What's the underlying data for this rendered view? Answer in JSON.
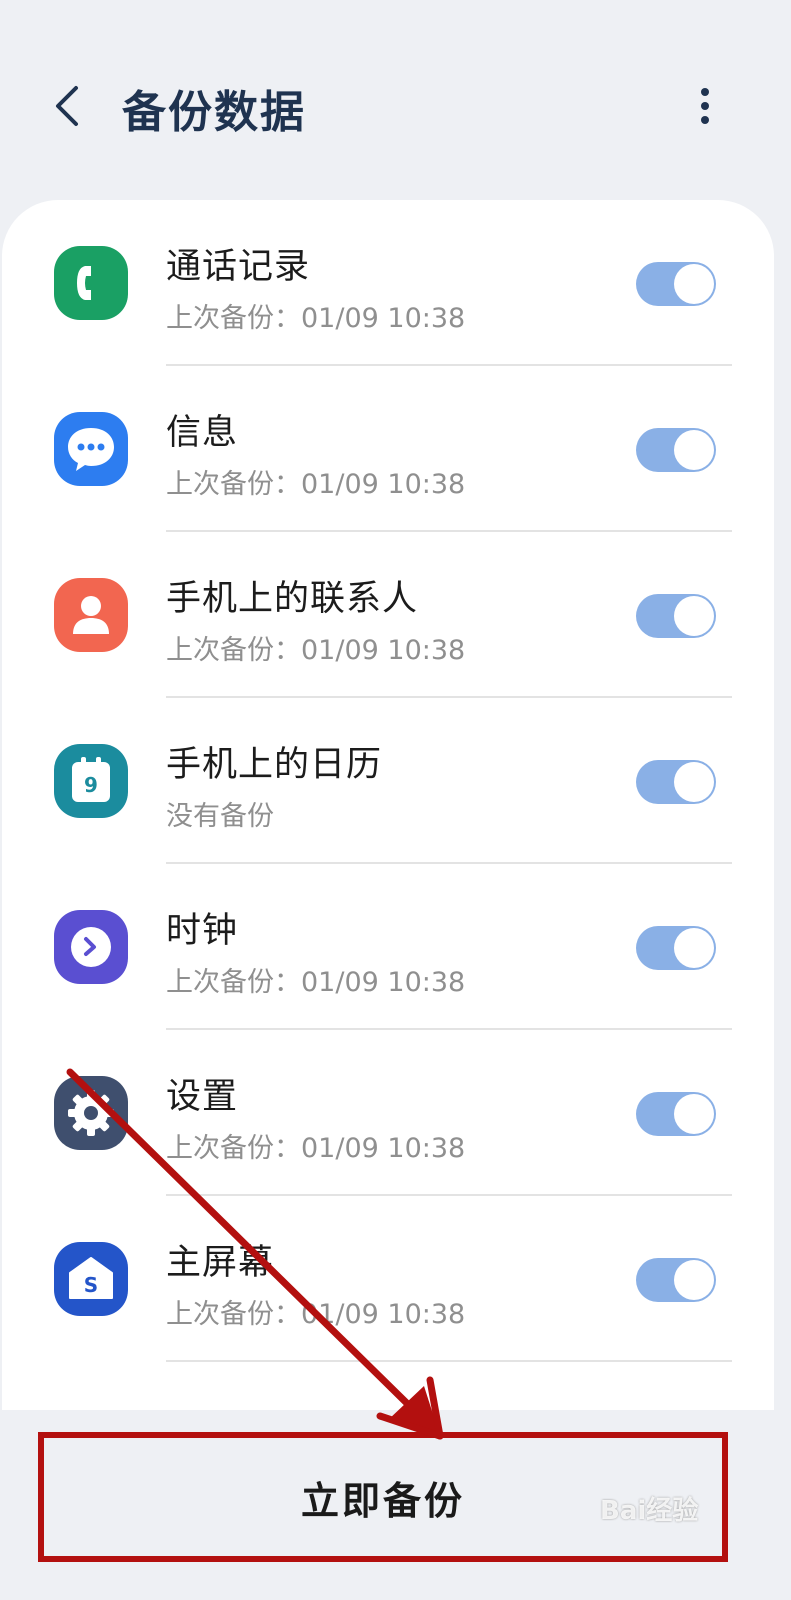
{
  "header": {
    "title": "备份数据",
    "back_icon": "chevron-left-icon",
    "more_icon": "more-vert-icon"
  },
  "items": [
    {
      "name": "通话记录",
      "status": "上次备份：01/09 10:38",
      "icon": "phone-icon",
      "icon_color": "#1aa064",
      "enabled": true
    },
    {
      "name": "信息",
      "status": "上次备份：01/09 10:38",
      "icon": "message-icon",
      "icon_color": "#2d7df0",
      "enabled": true
    },
    {
      "name": "手机上的联系人",
      "status": "上次备份：01/09 10:38",
      "icon": "contact-icon",
      "icon_color": "#f26650",
      "enabled": true
    },
    {
      "name": "手机上的日历",
      "status": "没有备份",
      "icon": "calendar-icon",
      "icon_color": "#1b8c9e",
      "calendar_day": "9",
      "enabled": true
    },
    {
      "name": "时钟",
      "status": "上次备份：01/09 10:38",
      "icon": "clock-icon",
      "icon_color": "#5a4fd1",
      "enabled": true
    },
    {
      "name": "设置",
      "status": "上次备份：01/09 10:38",
      "icon": "gear-icon",
      "icon_color": "#3f4f6e",
      "enabled": true
    },
    {
      "name": "主屏幕",
      "status": "上次备份：01/09 10:38",
      "icon": "home-s-icon",
      "icon_color": "#2455c9",
      "home_letter": "S",
      "enabled": true
    }
  ],
  "actions": {
    "backup_now": "立即备份"
  },
  "colors": {
    "toggle_on": "#8ab0e6",
    "title": "#1f3350",
    "annotation": "#b3100f"
  },
  "watermark": "Bai经验"
}
